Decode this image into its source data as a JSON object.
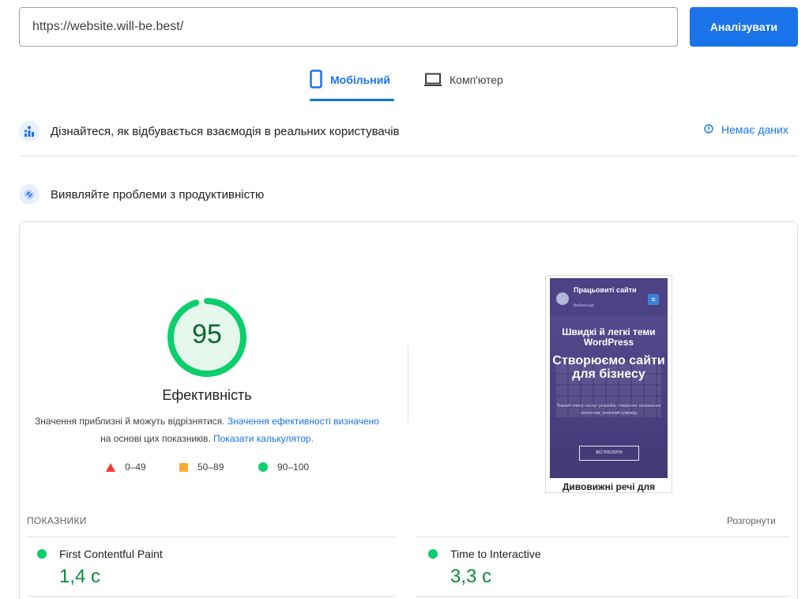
{
  "search": {
    "url_value": "https://website.will-be.best/",
    "analyze_label": "Аналізувати"
  },
  "tabs": [
    {
      "label": "Мобільний",
      "icon": "mobile-phone-icon",
      "active": true
    },
    {
      "label": "Комп'ютер",
      "icon": "desktop-icon",
      "active": false
    }
  ],
  "field_data": {
    "title": "Дізнайтеся, як відбувається взаємодія в реальних користувачів",
    "no_data_label": "Немає даних"
  },
  "lab_data": {
    "title": "Виявляйте проблеми з продуктивністю"
  },
  "performance": {
    "score": "95",
    "score_fraction": 0.95,
    "title": "Ефективність",
    "desc_text_1": "Значення приблизні й можуть відрізнятися.",
    "desc_link_1": "Значення ефективності визначено",
    "desc_text_2": "на основі цих показників.",
    "desc_link_2": "Показати калькулятор.",
    "legend": [
      {
        "range": "0–49",
        "shape": "triangle",
        "color": "#ff3333"
      },
      {
        "range": "50–89",
        "shape": "square",
        "color": "#ffaa33"
      },
      {
        "range": "90–100",
        "shape": "circle",
        "color": "#0cce6b"
      }
    ],
    "colors": {
      "pass": "#0cce6b",
      "pass_text": "#0d652d",
      "accent": "#1a73e8"
    }
  },
  "screenshot": {
    "brand": "Працьовиті сайти",
    "brand_sub": "Вебагенція",
    "headline_small": "Швидкі й легкі теми WordPress",
    "headline_big": "Створюємо сайти для бізнесу",
    "paragraph": "Повний спектр послуг: розробка, створення, наповнення контентом, технічний супровід",
    "button": "ВСІ ПОСЛУГИ",
    "bottom_text": "Дивовижні речі для"
  },
  "metrics": {
    "section_label": "ПОКАЗНИКИ",
    "expand_label": "Розгорнути",
    "items": [
      {
        "name": "First Contentful Paint",
        "value": "1,4 с"
      },
      {
        "name": "Time to Interactive",
        "value": "3,3 с"
      }
    ]
  }
}
